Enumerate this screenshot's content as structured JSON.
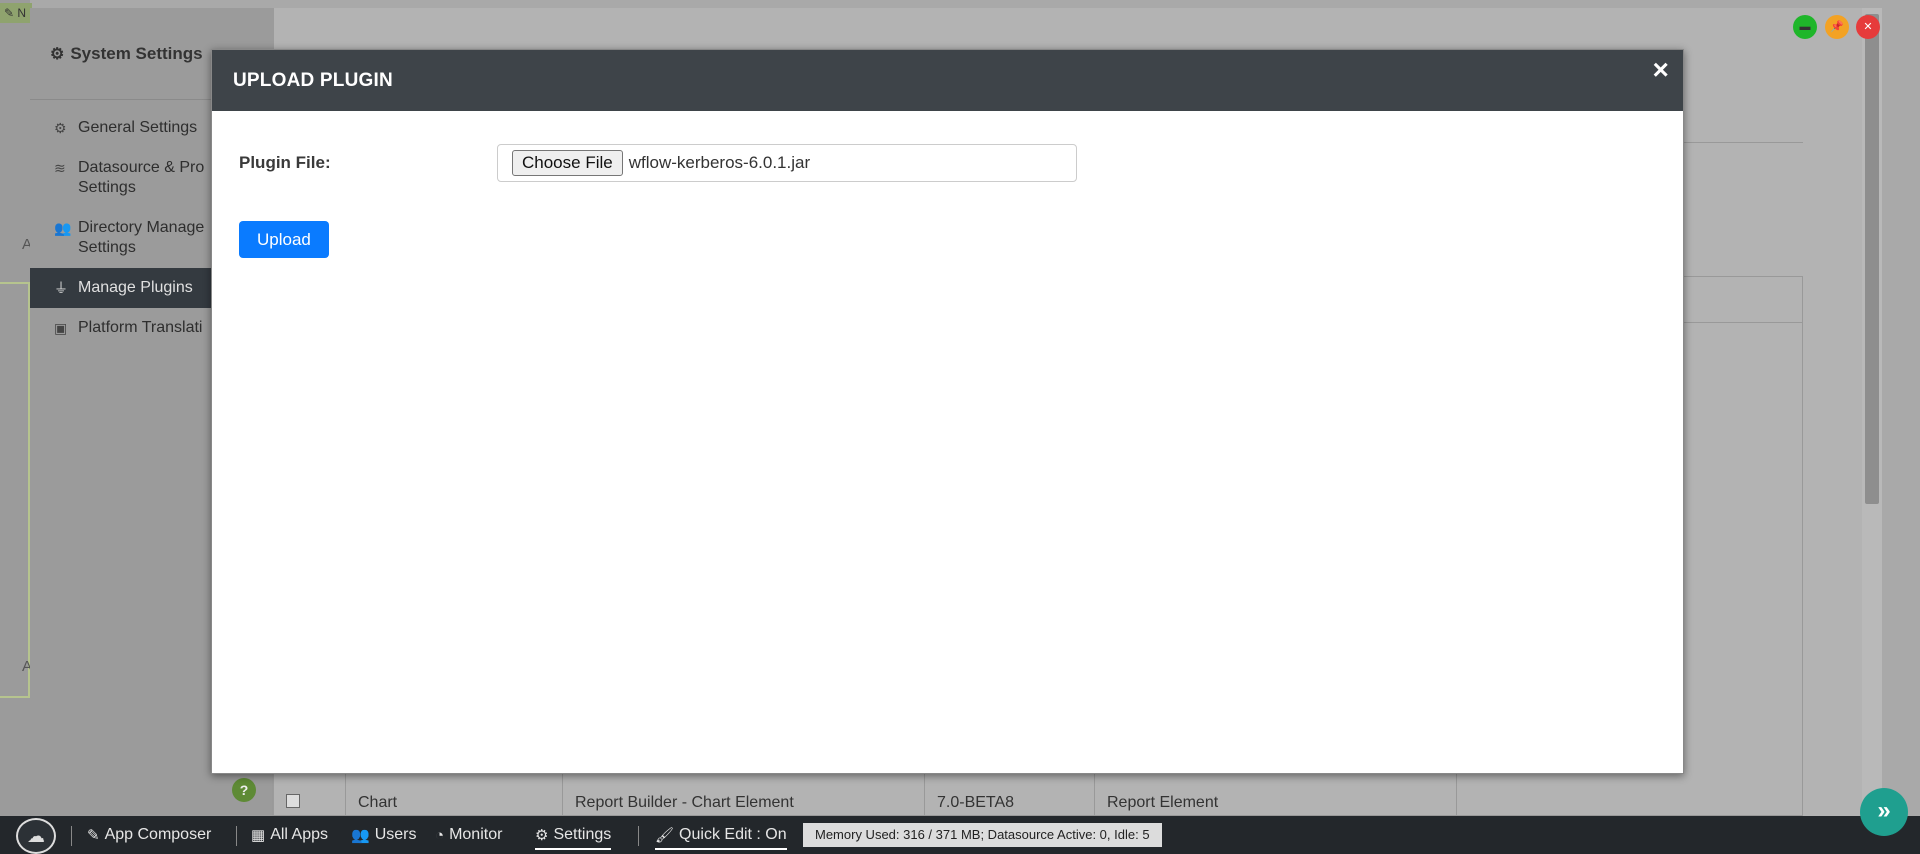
{
  "left_strip": {
    "tag": "✎ N",
    "letters": [
      "A",
      "A"
    ]
  },
  "settings": {
    "title": "System Settings",
    "items": [
      {
        "icon": "gear-icon",
        "label": "General Settings",
        "label2": ""
      },
      {
        "icon": "database-icon",
        "label": "Datasource & Pro",
        "label2": "Settings"
      },
      {
        "icon": "users-icon",
        "label": "Directory Manage",
        "label2": "Settings"
      },
      {
        "icon": "plug-icon",
        "label": "Manage Plugins",
        "label2": ""
      },
      {
        "icon": "translate-icon",
        "label": "Platform Translati",
        "label2": ""
      }
    ],
    "help": "?"
  },
  "table_row": {
    "name": "Chart",
    "description": "Report Builder - Chart Element",
    "version": "7.0-BETA8",
    "type": "Report Element"
  },
  "window_controls": {
    "minimize": "▬",
    "pin": "📌",
    "close": "✕"
  },
  "modal": {
    "title": "UPLOAD PLUGIN",
    "close": "×",
    "plugin_file_label": "Plugin File:",
    "choose_file_label": "Choose File",
    "file_name": "wflow-kerberos-6.0.1.jar",
    "upload_label": "Upload"
  },
  "bottom_bar": {
    "items": [
      {
        "icon": "edit-icon",
        "label": "App Composer"
      },
      {
        "icon": "grid-icon",
        "label": "All Apps"
      },
      {
        "icon": "users-icon",
        "label": "Users"
      },
      {
        "icon": "gauge-icon",
        "label": "Monitor"
      },
      {
        "icon": "gears-icon",
        "label": "Settings"
      },
      {
        "icon": "brush-icon",
        "label": "Quick Edit : On"
      }
    ],
    "status": "Memory Used: 316 / 371 MB; Datasource Active: 0, Idle: 5"
  }
}
